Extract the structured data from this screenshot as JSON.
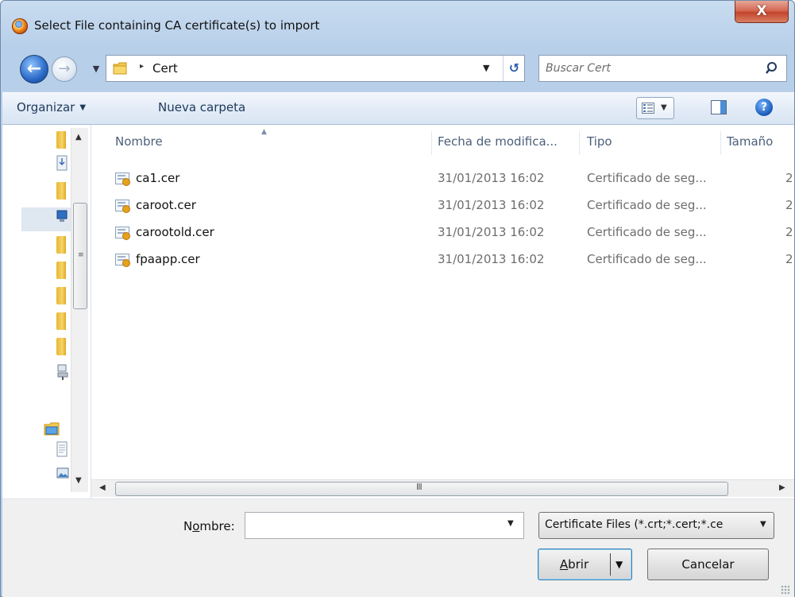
{
  "window": {
    "title": "Select File containing CA certificate(s) to import",
    "close_label": "X"
  },
  "address": {
    "crumb": "Cert",
    "separator": "▸",
    "dropdown_glyph": "▼",
    "refresh_glyph": "↺"
  },
  "search": {
    "placeholder": "Buscar Cert"
  },
  "toolbar": {
    "organize_label": "Organizar",
    "organize_caret": "▼",
    "new_folder_label": "Nueva carpeta",
    "view_dropdown_glyph": "▼",
    "help_glyph": "?"
  },
  "columns": {
    "name": "Nombre",
    "date": "Fecha de modifica...",
    "type": "Tipo",
    "size": "Tamaño"
  },
  "files": [
    {
      "name": "ca1.cer",
      "date": "31/01/2013 16:02",
      "type": "Certificado de seg...",
      "size": "2"
    },
    {
      "name": "caroot.cer",
      "date": "31/01/2013 16:02",
      "type": "Certificado de seg...",
      "size": "2"
    },
    {
      "name": "carootold.cer",
      "date": "31/01/2013 16:02",
      "type": "Certificado de seg...",
      "size": "2"
    },
    {
      "name": "fpaapp.cer",
      "date": "31/01/2013 16:02",
      "type": "Certificado de seg...",
      "size": "2"
    }
  ],
  "bottom": {
    "name_label_pre": "N",
    "name_label_underline": "o",
    "name_label_post": "mbre:",
    "name_value": "",
    "filter_value": "Certificate Files (*.crt;*.cert;*.ce",
    "open_label_underline": "A",
    "open_label_post": "brir",
    "cancel_label": "Cancelar"
  },
  "icons": {
    "app": "firefox-icon",
    "folder": "folder-icon",
    "certificate": "certificate-icon"
  },
  "colors": {
    "title_gradient": "#b7cfe9",
    "close_button": "#c4452c",
    "link_text": "#1e395b",
    "secondary_text": "#6d6d6d"
  }
}
